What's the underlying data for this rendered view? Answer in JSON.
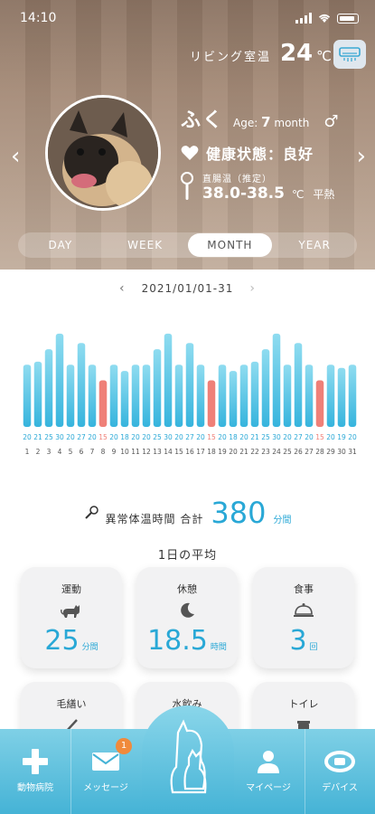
{
  "status": {
    "time": "14:10"
  },
  "room": {
    "label": "リビング室温",
    "temp": "24",
    "unit": "℃"
  },
  "pet": {
    "name": "ふく",
    "age_label": "Age:",
    "age_value": "7",
    "age_unit": "month",
    "sex": "♂",
    "health": "健康状態：良好",
    "temp_label": "直腸温（推定）",
    "temp_range": "38.0-38.5",
    "temp_unit": "℃",
    "temp_status": "平熱"
  },
  "tabs": [
    "DAY",
    "WEEK",
    "MONTH",
    "YEAR"
  ],
  "active_tab": "MONTH",
  "date_range": "2021/01/01-31",
  "chart_data": {
    "type": "bar",
    "categories": [
      "1",
      "2",
      "3",
      "4",
      "5",
      "6",
      "7",
      "8",
      "9",
      "10",
      "11",
      "12",
      "13",
      "14",
      "15",
      "16",
      "17",
      "18",
      "19",
      "20",
      "21",
      "22",
      "23",
      "24",
      "25",
      "26",
      "27",
      "28",
      "29",
      "30",
      "31"
    ],
    "values": [
      20,
      21,
      25,
      30,
      20,
      27,
      20,
      15,
      20,
      18,
      20,
      20,
      25,
      30,
      20,
      27,
      20,
      15,
      20,
      18,
      20,
      21,
      25,
      30,
      20,
      27,
      20,
      15,
      20,
      19,
      20
    ],
    "highlight_index": [
      7,
      17,
      27
    ],
    "colors": {
      "normal": "#36b4dd",
      "normal_top": "#8fdcf0",
      "alert": "#ef8078"
    },
    "ylim": [
      0,
      32
    ]
  },
  "abnormal": {
    "label": "異常体温時間 合計",
    "value": "380",
    "unit": "分間"
  },
  "avg_title": "1日の平均",
  "cards": [
    {
      "title": "運動",
      "icon": "cat-icon",
      "value": "25",
      "unit": "分間"
    },
    {
      "title": "休憩",
      "icon": "moon-icon",
      "value": "18.5",
      "unit": "時間"
    },
    {
      "title": "食事",
      "icon": "dish-icon",
      "value": "3",
      "unit": "回"
    },
    {
      "title": "毛繕い",
      "icon": "brush-icon",
      "value": "",
      "unit": ""
    },
    {
      "title": "水飲み",
      "icon": "water-icon",
      "value": "",
      "unit": ""
    },
    {
      "title": "トイレ",
      "icon": "toilet-icon",
      "value": "",
      "unit": ""
    }
  ],
  "nav": {
    "hospital": "動物病院",
    "message": "メッセージ",
    "message_badge": "1",
    "mypage": "マイページ",
    "device": "デバイス"
  }
}
